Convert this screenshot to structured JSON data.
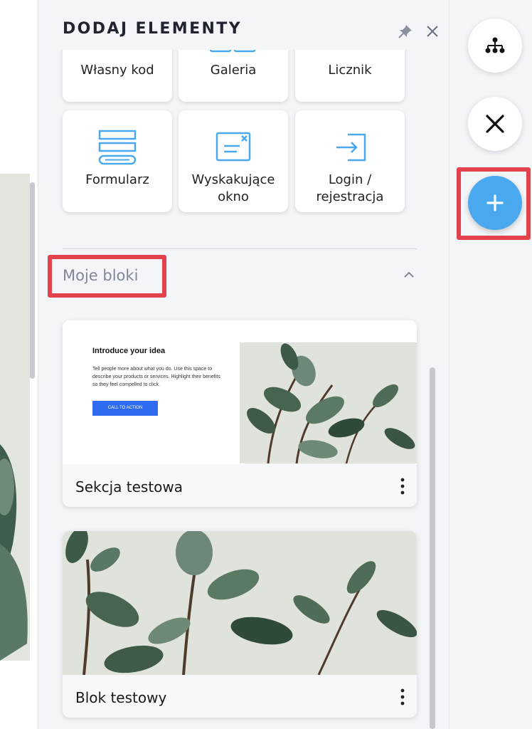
{
  "panel": {
    "title": "DODAJ ELEMENTY"
  },
  "elements": [
    {
      "label": "Własny kod",
      "icon": "code-icon"
    },
    {
      "label": "Galeria",
      "icon": "gallery-icon"
    },
    {
      "label": "Licznik",
      "icon": "counter-icon"
    },
    {
      "label": "Formularz",
      "icon": "form-icon"
    },
    {
      "label_lines": [
        "Wyskakujące",
        "okno"
      ],
      "icon": "popup-icon"
    },
    {
      "label_lines": [
        "Login /",
        "rejestracja"
      ],
      "icon": "login-icon"
    }
  ],
  "my_blocks": {
    "title": "Moje bloki",
    "items": [
      {
        "caption": "Sekcja testowa",
        "preview": {
          "heading": "Introduce your idea",
          "body": "Tell people more about what you do. Use this space to describe your products or services. Highlight their benefits so they feel compelled to click.",
          "button": "CALL TO ACTION"
        }
      },
      {
        "caption": "Blok testowy"
      }
    ]
  },
  "colors": {
    "accent": "#4aa9ee",
    "highlight": "#e3424d",
    "cta": "#2f6bf0",
    "icon_blue": "#4aa9ee"
  }
}
